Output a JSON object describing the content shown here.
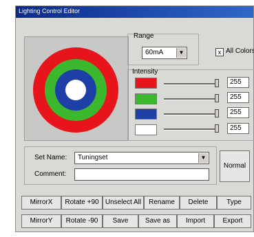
{
  "window": {
    "title": "Lighting Control Editor"
  },
  "range": {
    "label": "Range",
    "value": "60mA"
  },
  "all_colors": {
    "label": "All Colors",
    "checked": "x"
  },
  "intensity": {
    "label": "Intensity",
    "rows": [
      {
        "color": "#e8141c",
        "value": "255"
      },
      {
        "color": "#3cb82e",
        "value": "255"
      },
      {
        "color": "#1d3fa6",
        "value": "255"
      },
      {
        "color": "#ffffff",
        "value": "255"
      }
    ]
  },
  "preview": {
    "ring_colors": [
      "#e8141c",
      "#3cb82e",
      "#1d3fa6",
      "#ffffff"
    ]
  },
  "set": {
    "name_label": "Set Name:",
    "name_value": "Tuningset",
    "comment_label": "Comment:",
    "comment_value": ""
  },
  "normal_button": "Normal",
  "buttons_row1": [
    "MirrorX",
    "Rotate +90",
    "Unselect All",
    "Rename",
    "Delete",
    "Type"
  ],
  "buttons_row2": [
    "MirrorY",
    "Rotate -90",
    "Save",
    "Save as",
    "Import",
    "Export"
  ]
}
